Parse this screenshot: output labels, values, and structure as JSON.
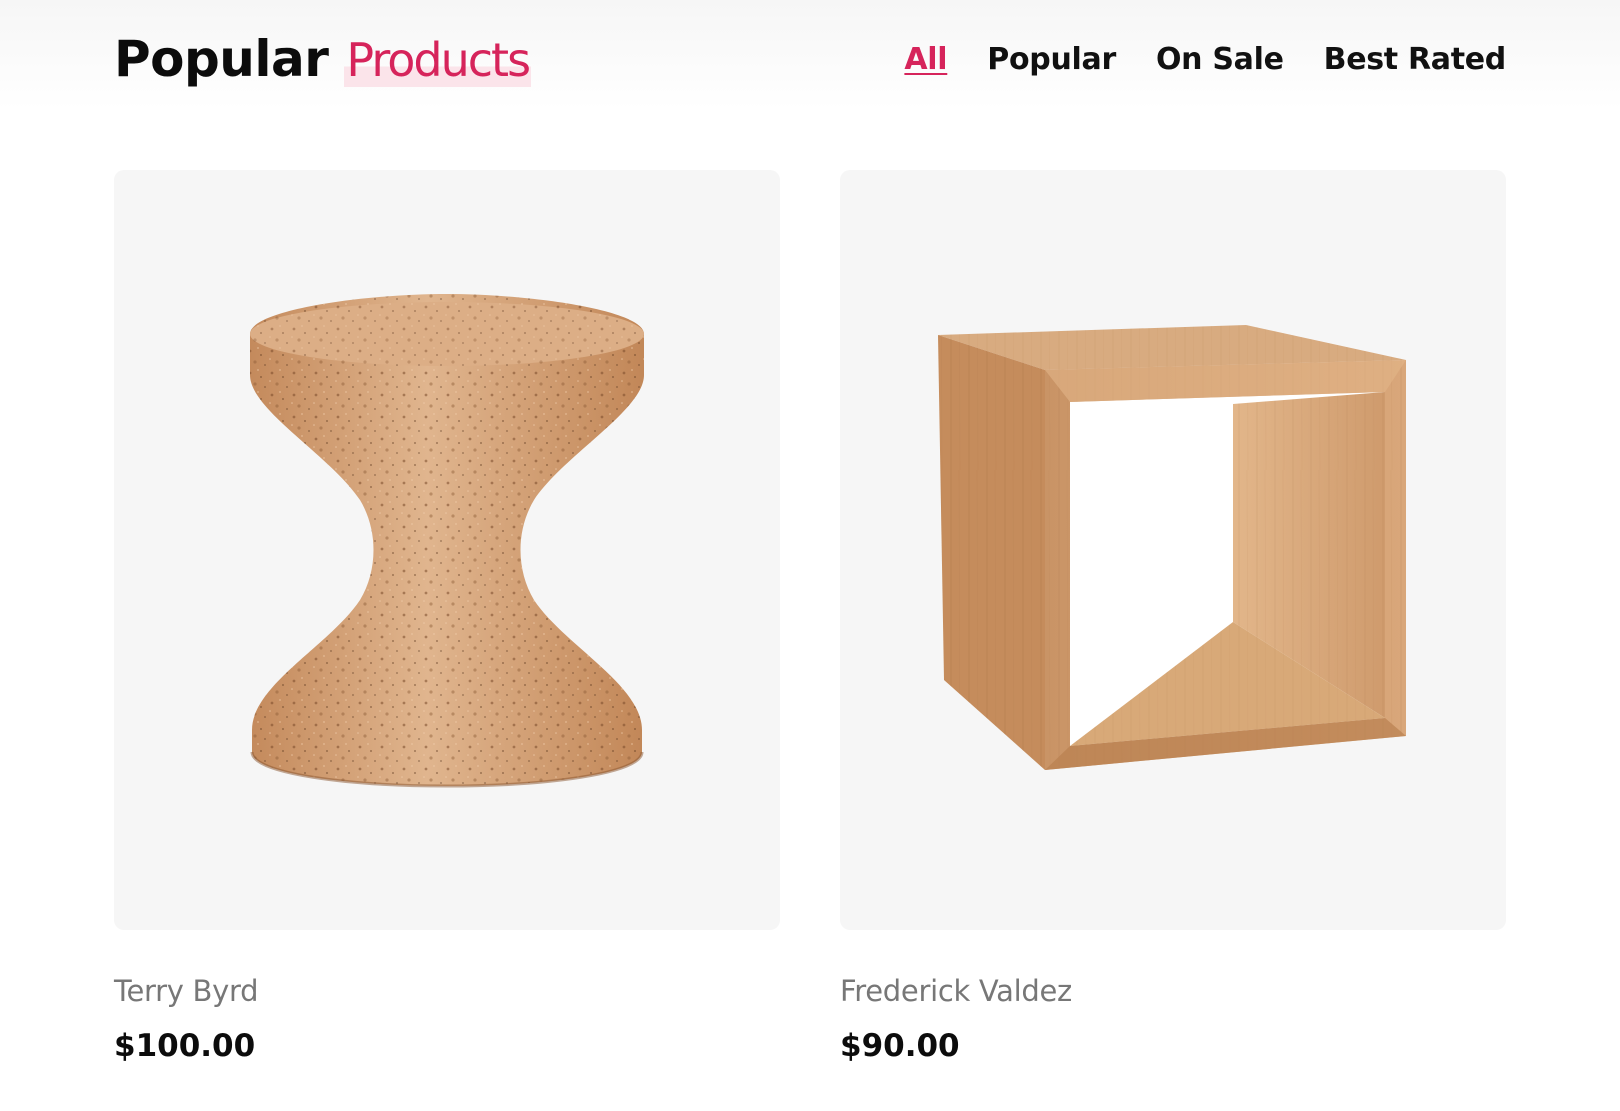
{
  "section": {
    "title_strong": "Popular",
    "title_accent": "Products"
  },
  "nav": {
    "items": [
      {
        "label": "All",
        "active": true
      },
      {
        "label": "Popular",
        "active": false
      },
      {
        "label": "On Sale",
        "active": false
      },
      {
        "label": "Best Rated",
        "active": false
      }
    ]
  },
  "products": [
    {
      "name": "Terry Byrd",
      "price": "$100.00",
      "image": "cork-stool"
    },
    {
      "name": "Frederick Valdez",
      "price": "$90.00",
      "image": "wooden-cube-side-table"
    }
  ],
  "colors": {
    "accent": "#d6245b",
    "card_bg": "#f6f6f6",
    "muted_text": "#777777"
  }
}
